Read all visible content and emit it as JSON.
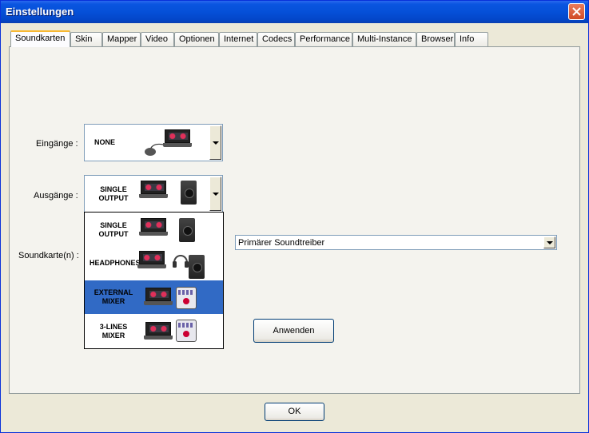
{
  "window": {
    "title": "Einstellungen"
  },
  "tabs": [
    {
      "label": "Soundkarten"
    },
    {
      "label": "Skin"
    },
    {
      "label": "Mapper"
    },
    {
      "label": "Video"
    },
    {
      "label": "Optionen"
    },
    {
      "label": "Internet"
    },
    {
      "label": "Codecs"
    },
    {
      "label": "Performance"
    },
    {
      "label": "Multi-Instance"
    },
    {
      "label": "Browser"
    },
    {
      "label": "Info"
    }
  ],
  "inputs": {
    "label": "Eingänge :",
    "value": "NONE"
  },
  "outputs": {
    "label": "Ausgänge :",
    "value_line1": "SINGLE",
    "value_line2": "OUTPUT",
    "options": [
      {
        "line1": "SINGLE",
        "line2": "OUTPUT"
      },
      {
        "line1": "HEADPHONES",
        "line2": ""
      },
      {
        "line1": "EXTERNAL",
        "line2": "MIXER"
      },
      {
        "line1": "3-LINES",
        "line2": "MIXER"
      }
    ],
    "selected_option": "EXTERNAL MIXER"
  },
  "soundcard": {
    "label": "Soundkarte(n) :",
    "value": "Primärer Soundtreiber"
  },
  "buttons": {
    "apply": "Anwenden",
    "ok": "OK"
  },
  "colors": {
    "selection": "#316ac5",
    "titlebar": "#0550d8",
    "close": "#d04a25"
  }
}
